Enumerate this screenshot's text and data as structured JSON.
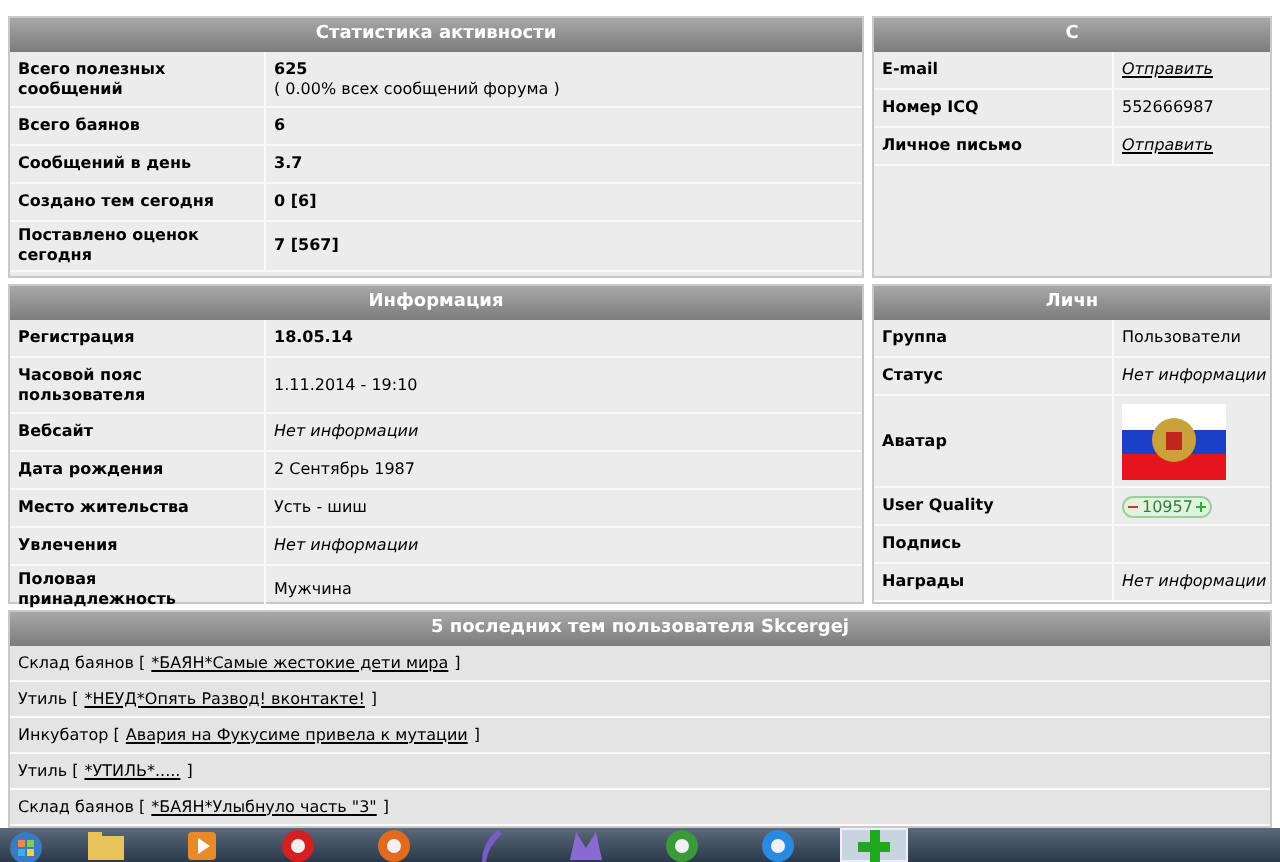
{
  "activity": {
    "title": "Статистика активности",
    "rows": [
      {
        "label": "Всего полезных сообщений",
        "value": "625",
        "note": "( 0.00% всех сообщений форума )"
      },
      {
        "label": "Всего баянов",
        "value": "6"
      },
      {
        "label": "Сообщений в день",
        "value": "3.7"
      },
      {
        "label": "Создано тем сегодня",
        "value": "0 [6]"
      },
      {
        "label": "Поставлено оценок сегодня",
        "value": "7 [567]"
      }
    ]
  },
  "contacts": {
    "title": "С",
    "rows": [
      {
        "label": "E-mail",
        "value": "Отправить",
        "kind": "link"
      },
      {
        "label": "Номер ICQ",
        "value": "552666987",
        "kind": "plain"
      },
      {
        "label": "Личное письмо",
        "value": "Отправить",
        "kind": "link"
      }
    ]
  },
  "info": {
    "title": "Информация",
    "rows": [
      {
        "label": "Регистрация",
        "value": "18.05.14",
        "kind": "bold"
      },
      {
        "label": "Часовой пояс пользователя",
        "value": "1.11.2014 - 19:10",
        "kind": "plain"
      },
      {
        "label": "Вебсайт",
        "value": "Нет информации",
        "kind": "italic"
      },
      {
        "label": "Дата рождения",
        "value": "2 Сентябрь 1987",
        "kind": "plain"
      },
      {
        "label": "Место жительства",
        "value": "Усть - шиш",
        "kind": "plain"
      },
      {
        "label": "Увлечения",
        "value": "Нет информации",
        "kind": "italic"
      },
      {
        "label": "Половая принадлежность",
        "value": "Мужчина",
        "kind": "plain"
      }
    ]
  },
  "personal": {
    "title": "Личн",
    "rows": [
      {
        "label": "Группа",
        "value": "Пользователи",
        "kind": "plain"
      },
      {
        "label": "Статус",
        "value": "Нет информации",
        "kind": "italic"
      },
      {
        "label": "Аватар",
        "kind": "avatar"
      },
      {
        "label": "User Quality",
        "value": "10957",
        "kind": "quality"
      },
      {
        "label": "Подпись",
        "kind": "empty"
      },
      {
        "label": "Награды",
        "value": "Нет информации",
        "kind": "italic"
      }
    ]
  },
  "topics": {
    "title": "5 последних тем пользователя Skcergej",
    "rows": [
      {
        "forum": "Склад баянов [",
        "link": "*БАЯН*Самые жестокие дети мира",
        "close": "]"
      },
      {
        "forum": "Утиль [",
        "link": "*НЕУД*Опять Развод! вконтакте!",
        "close": "]"
      },
      {
        "forum": "Инкубатор [",
        "link": "Авария на Фукусиме привела к мутации",
        "close": "]"
      },
      {
        "forum": "Утиль [",
        "link": "*УТИЛЬ*.....",
        "close": "]"
      },
      {
        "forum": "Склад баянов [",
        "link": "*БАЯН*Улыбнуло часть \"3\"",
        "close": "]"
      }
    ]
  },
  "taskbar": {
    "apps": [
      {
        "kind": "folder",
        "selected": false
      },
      {
        "kind": "player",
        "selected": false
      },
      {
        "kind": "opera",
        "selected": false
      },
      {
        "kind": "firefox",
        "selected": false
      },
      {
        "kind": "feather",
        "selected": false
      },
      {
        "kind": "purple",
        "selected": false
      },
      {
        "kind": "chrome",
        "selected": false
      },
      {
        "kind": "ie",
        "selected": false
      },
      {
        "kind": "plus",
        "selected": true
      }
    ]
  }
}
